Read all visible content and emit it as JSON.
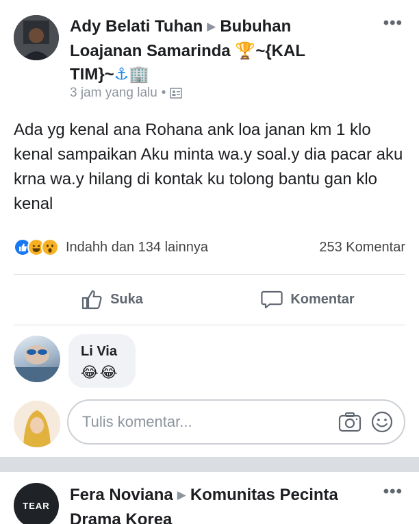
{
  "post1": {
    "author": "Ady Belati Tuhan",
    "group": "Bubuhan Loajanan Samarinda",
    "group_tail": "~{KAL TIM}~",
    "time": "3 jam yang lalu",
    "text": "Ada yg kenal ana Rohana ank loa janan km 1 klo kenal sampaikan Aku minta wa.y soal.y dia pacar aku krna wa.y hilang di kontak ku tolong bantu gan klo kenal",
    "reactions_text": "Indahh dan 134 lainnya",
    "comments_count": "253 Komentar",
    "like_label": "Suka",
    "comment_label": "Komentar"
  },
  "comment": {
    "name": "Li Via"
  },
  "composer": {
    "placeholder": "Tulis komentar..."
  },
  "post2": {
    "author": "Fera Noviana",
    "group": "Komunitas Pecinta Drama Korea",
    "avatar_text": "TEAR"
  },
  "colors": {
    "like_blue": "#1877f2",
    "haha_yellow": "#f7b125",
    "text_primary": "#1c1e21",
    "text_secondary": "#8d949e",
    "divider": "#dadde1"
  }
}
